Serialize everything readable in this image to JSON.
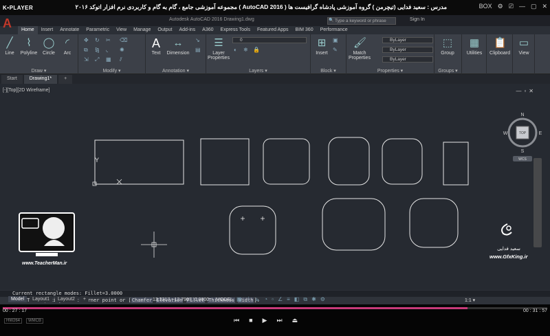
{
  "player": {
    "logo": "K•PLAYER",
    "video_title": "مجموعه آموزشی جامع ، گام به گام و کاربردی نرم افزار  اتوکد ۲۰۱۶ ( AutoCAD  2016 )  مدرس : سعید فدایی (تیچرمن ) گروه آموزشی پادشاه گرافیست ها",
    "controls": [
      "BOX",
      "⚙",
      "⎚",
      "—",
      "▢",
      "✕"
    ],
    "time_current": "00 : 27 : 17",
    "time_total": "00 : 31 : 57",
    "progress": 0.854,
    "badges": [
      "HW264",
      "WMCB"
    ],
    "buttons": [
      "⏮",
      "■",
      "▶",
      "⏭",
      "⏏"
    ]
  },
  "acad": {
    "app_button": "A",
    "window_title": "Autodesk AutoCAD 2016    Drawing1.dwg",
    "search_placeholder": "Type a keyword or phrase",
    "signin": "Sign In",
    "ribbon_tabs": [
      "Home",
      "Insert",
      "Annotate",
      "Parametric",
      "View",
      "Manage",
      "Output",
      "Add-ins",
      "A360",
      "Express Tools",
      "Featured Apps",
      "BIM 360",
      "Performance"
    ],
    "panels": {
      "draw": {
        "title": "Draw ▾",
        "tools": [
          "Line",
          "Polyline",
          "Circle",
          "Arc"
        ]
      },
      "modify": {
        "title": "Modify ▾"
      },
      "annotation": {
        "title": "Annotation ▾",
        "tools": [
          "Text",
          "Dimension"
        ]
      },
      "layers": {
        "title": "Layers ▾",
        "tools": [
          "Layer Properties"
        ],
        "current_layer": "0"
      },
      "block": {
        "title": "Block ▾",
        "tools": [
          "Insert"
        ]
      },
      "properties": {
        "title": "Properties ▾",
        "tools": [
          "Match Properties"
        ],
        "color": "ByLayer",
        "linetype": "ByLayer",
        "lineweight": "ByLayer"
      },
      "groups": {
        "title": "Groups ▾",
        "tools": [
          "Group"
        ]
      },
      "utilities": {
        "title": "",
        "tools": [
          "Utilities"
        ]
      },
      "clipboard": {
        "title": "",
        "tools": [
          "Clipboard"
        ]
      },
      "view": {
        "title": "",
        "tools": [
          "View"
        ]
      }
    },
    "doc_tabs": [
      "Start",
      "Drawing1*",
      "+"
    ],
    "viewport_label": "[-][Top][2D Wireframe]",
    "viewcube": {
      "top": "TOP",
      "north": "N",
      "south": "S",
      "east": "E",
      "west": "W",
      "wcs": "WCS"
    },
    "command_history": "Current rectangle modes:  Fillet=3.0000",
    "command_prefix": "✕ ",
    "command_name": "RECTANG",
    "command_prompt": " Specify first corner point or [",
    "command_options": [
      "Chamfer",
      "Elevation",
      "Fillet",
      "Thickness",
      "Width"
    ],
    "command_suffix": "]:",
    "layout_tabs": [
      "Model",
      "Layout1",
      "Layout2",
      "+"
    ],
    "coords": "13.3317, -13.7907, 0.0000",
    "model_status": "MODEL",
    "scale": "1:1 ▾"
  },
  "watermarks": {
    "teacher_brand": "TeacherMan",
    "teacher_url": "www.TeacherMan.ir",
    "gfx_name": "سعید فدایی",
    "gfx_url": "www.GfxKing.ir"
  },
  "colors": {
    "accent": "#c73a7a",
    "autocad_red": "#c0392b",
    "canvas": "#262a31"
  }
}
